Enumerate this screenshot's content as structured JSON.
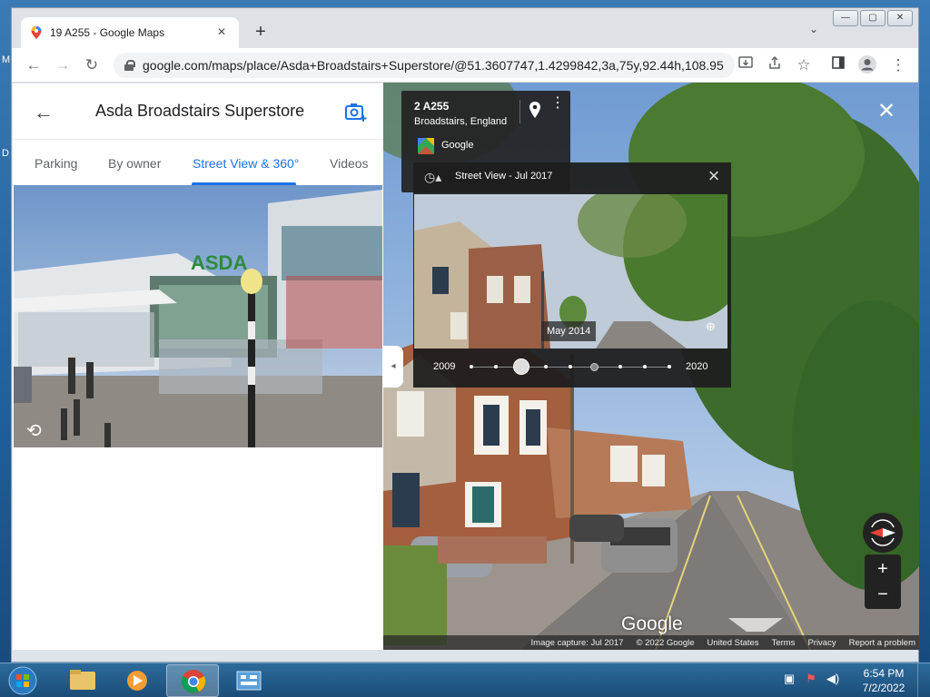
{
  "desktop": {
    "letter_1": "M",
    "letter_2": "D"
  },
  "browser": {
    "tab_title": "19 A255 - Google Maps",
    "tab_close": "×",
    "new_tab": "+",
    "tab_search": "⌄",
    "url": "google.com/maps/place/Asda+Broadstairs+Superstore/@51.3607747,1.4299842,3a,75y,92.44h,108.95t...",
    "window_buttons": [
      "—",
      "▢",
      "✕"
    ]
  },
  "panel": {
    "title": "Asda Broadstairs Superstore",
    "tabs": [
      {
        "label": "Parking",
        "active": false
      },
      {
        "label": "By owner",
        "active": false
      },
      {
        "label": "Street View & 360°",
        "active": true
      },
      {
        "label": "Videos",
        "active": false
      }
    ],
    "photo_store_sign": "ASDA"
  },
  "streetview": {
    "address": "2 A255",
    "locality": "Broadstairs, England",
    "provider": "Google",
    "time_machine": {
      "title": "Street View - Jul 2017",
      "preview_date": "May 2014",
      "start_year": "2009",
      "end_year": "2020",
      "dot_count": 9,
      "selected_index": 2,
      "current_index": 5
    },
    "watermark": "Google",
    "footer": [
      "Image capture: Jul 2017",
      "© 2022 Google",
      "United States",
      "Terms",
      "Privacy",
      "Report a problem"
    ],
    "zoom_in": "+",
    "zoom_out": "−",
    "collapse": "◂",
    "close": "✕"
  },
  "taskbar": {
    "time": "6:54 PM",
    "date": "7/2/2022"
  },
  "colors": {
    "accent": "#1a73e8",
    "window_frame": "#dee1e6",
    "taskbar": "#1b4d78"
  }
}
